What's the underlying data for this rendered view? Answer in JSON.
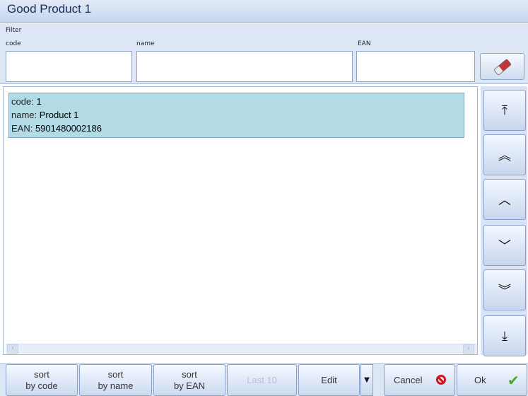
{
  "window": {
    "title": "Good Product 1"
  },
  "filter": {
    "section_label": "Filter",
    "code_label": "code",
    "name_label": "name",
    "ean_label": "EAN",
    "code_value": "",
    "name_value": "",
    "ean_value": ""
  },
  "list": {
    "items": [
      {
        "code_label": "code:",
        "code": "1",
        "name_label": "name:",
        "name": "Product 1",
        "ean_label": "EAN:",
        "ean": "5901480002186"
      }
    ]
  },
  "nav": {
    "icons": [
      "first-icon",
      "page-up-icon",
      "up-icon",
      "down-icon",
      "page-down-icon",
      "last-icon"
    ]
  },
  "bottom": {
    "sort_code_l1": "sort",
    "sort_code_l2": "by code",
    "sort_name_l1": "sort",
    "sort_name_l2": "by name",
    "sort_ean_l1": "sort",
    "sort_ean_l2": "by EAN",
    "last10": "Last 10",
    "edit": "Edit",
    "cancel": "Cancel",
    "ok": "Ok"
  },
  "colors": {
    "selected_row": "#b2dbe6",
    "ok_check": "#49a626",
    "cancel_icon": "#d2141a"
  }
}
